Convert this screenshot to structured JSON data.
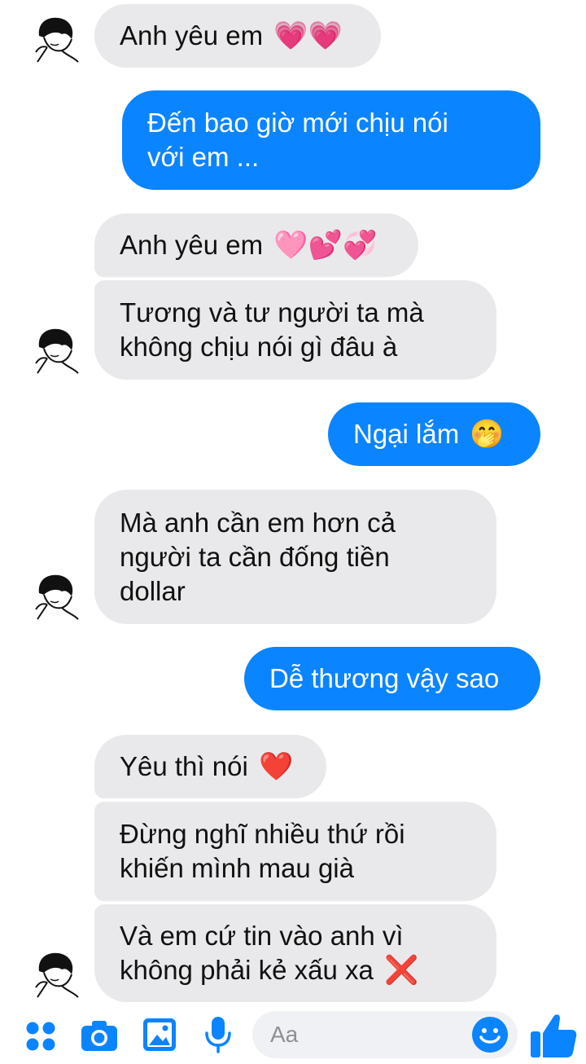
{
  "messages": [
    {
      "from": "them",
      "text": "Anh yêu em",
      "emoji": "💗💗"
    },
    {
      "from": "me",
      "lines": [
        "Đến bao giờ mới chịu nói",
        "với em ..."
      ]
    },
    {
      "from": "them",
      "text": "Anh yêu em",
      "emoji": "🩷💕💞"
    },
    {
      "from": "them",
      "lines": [
        "Tương và tư người ta mà",
        "không chịu nói gì đâu à"
      ]
    },
    {
      "from": "me",
      "text": "Ngại lắm",
      "emoji": "🤭"
    },
    {
      "from": "them",
      "lines": [
        "Mà anh cần em hơn cả",
        "người ta cần đống tiền",
        "dollar"
      ]
    },
    {
      "from": "me",
      "text": "Dễ thương vậy sao"
    },
    {
      "from": "them",
      "text": "Yêu thì nói",
      "emoji": "❤️"
    },
    {
      "from": "them",
      "lines": [
        "Đừng nghĩ nhiều thứ rồi",
        "khiến mình mau già"
      ]
    },
    {
      "from": "them",
      "lines": [
        "Và em cứ tin vào anh vì",
        "không phải kẻ xấu xa"
      ],
      "emoji": "❌"
    }
  ],
  "composer": {
    "placeholder": "Aa",
    "icons": [
      "apps-icon",
      "camera-icon",
      "gallery-icon",
      "microphone-icon",
      "emoji-icon",
      "like-icon"
    ]
  },
  "colors": {
    "outgoing": "#0b84ff",
    "incoming": "#e9e9eb",
    "accent": "#0b84ff"
  }
}
